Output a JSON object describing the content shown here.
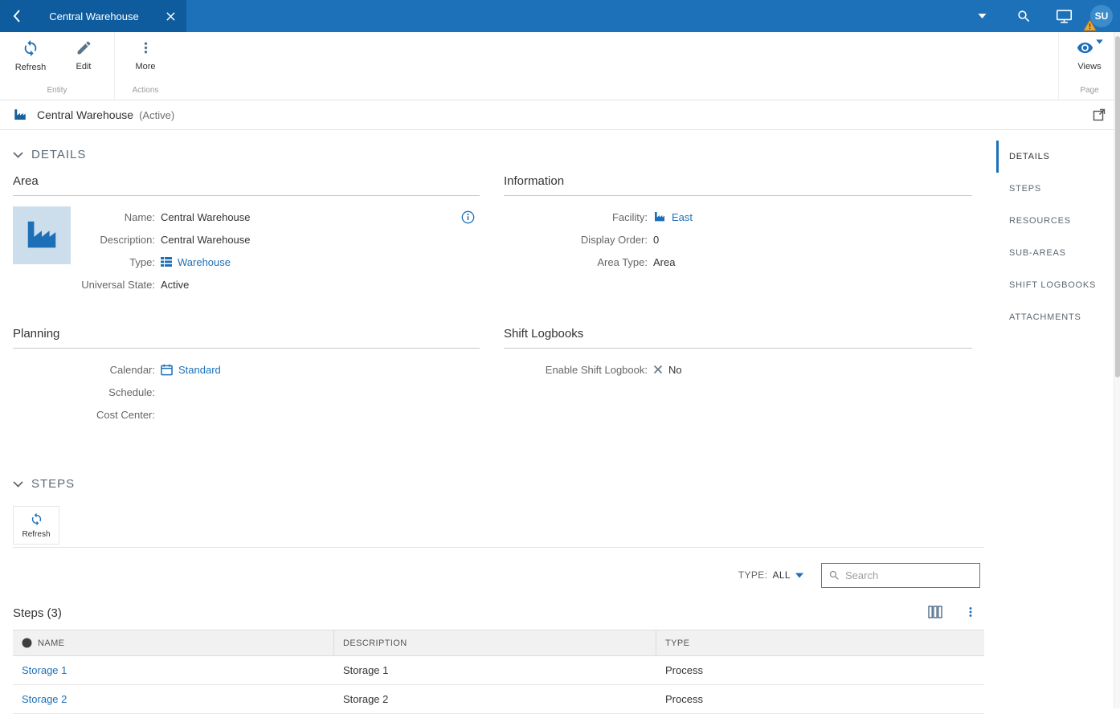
{
  "colors": {
    "topbar_blue": "#1d71b8",
    "tab_blue": "#0e5c9d",
    "accent_blue": "#1d70b8",
    "link_blue": "#1d70b8",
    "warning_orange": "#f2a93b",
    "table_header_gray": "#f1f1f1"
  },
  "icons": {
    "back-icon": "‹",
    "close-icon": "×",
    "chevron-down-icon": "▾",
    "search-icon": "magnifier",
    "display-icon": "monitor",
    "warning-icon": "⚠",
    "refresh-icon": "sync-arrows",
    "edit-icon": "pencil",
    "more-icon": "⋮",
    "eye-icon": "eye",
    "factory-icon": "factory",
    "info-icon": "ⓘ",
    "type-grid-icon": "list-grid",
    "calendar-icon": "calendar",
    "no-x-icon": "✕",
    "columns-icon": "table-columns",
    "kebab-icon": "⋮",
    "open-window-icon": "open-in-window",
    "name-circle-icon": "●"
  },
  "topbar": {
    "tab_title": "Central Warehouse",
    "avatar_initials": "SU"
  },
  "toolbar": {
    "refresh_label": "Refresh",
    "edit_label": "Edit",
    "more_label": "More",
    "entity_group_label": "Entity",
    "actions_group_label": "Actions",
    "views_label": "Views",
    "page_group_label": "Page"
  },
  "entity_header": {
    "title": "Central Warehouse",
    "state": "(Active)"
  },
  "details": {
    "section_title": "DETAILS",
    "area": {
      "title": "Area",
      "name_label": "Name:",
      "name_value": "Central Warehouse",
      "description_label": "Description:",
      "description_value": "Central Warehouse",
      "type_label": "Type:",
      "type_value": "Warehouse",
      "universal_state_label": "Universal State:",
      "universal_state_value": "Active"
    },
    "information": {
      "title": "Information",
      "facility_label": "Facility:",
      "facility_value": "East",
      "display_order_label": "Display Order:",
      "display_order_value": "0",
      "area_type_label": "Area Type:",
      "area_type_value": "Area"
    },
    "planning": {
      "title": "Planning",
      "calendar_label": "Calendar:",
      "calendar_value": "Standard",
      "schedule_label": "Schedule:",
      "schedule_value": "",
      "cost_center_label": "Cost Center:",
      "cost_center_value": ""
    },
    "shift_logbooks": {
      "title": "Shift Logbooks",
      "enable_label": "Enable Shift Logbook:",
      "enable_value": "No"
    }
  },
  "steps": {
    "section_title": "STEPS",
    "refresh_label": "Refresh",
    "type_filter_label": "TYPE:",
    "type_filter_value": "ALL",
    "search_placeholder": "Search",
    "search_value": "",
    "table_title": "Steps (3)",
    "columns": [
      "NAME",
      "DESCRIPTION",
      "TYPE"
    ],
    "rows": [
      {
        "name": "Storage 1",
        "description": "Storage 1",
        "type": "Process"
      },
      {
        "name": "Storage 2",
        "description": "Storage 2",
        "type": "Process"
      }
    ]
  },
  "right_nav": {
    "active_item": "DETAILS",
    "items": [
      "DETAILS",
      "STEPS",
      "RESOURCES",
      "SUB-AREAS",
      "SHIFT LOGBOOKS",
      "ATTACHMENTS"
    ]
  }
}
